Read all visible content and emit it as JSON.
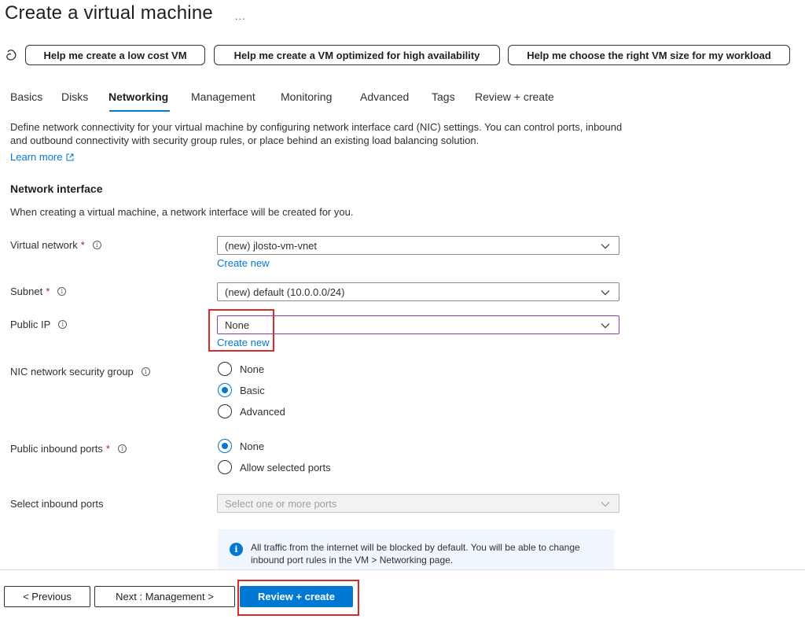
{
  "page": {
    "title": "Create a virtual machine",
    "more": "..."
  },
  "copilot": {
    "icon": "copilot-icon",
    "prompts": [
      "Help me create a low cost VM",
      "Help me create a VM optimized for high availability",
      "Help me choose the right VM size for my workload"
    ]
  },
  "tabs": [
    {
      "label": "Basics"
    },
    {
      "label": "Disks"
    },
    {
      "label": "Networking",
      "active": true
    },
    {
      "label": "Management"
    },
    {
      "label": "Monitoring"
    },
    {
      "label": "Advanced"
    },
    {
      "label": "Tags"
    },
    {
      "label": "Review + create"
    }
  ],
  "intro": {
    "description": "Define network connectivity for your virtual machine by configuring network interface card (NIC) settings. You can control ports, inbound and outbound connectivity with security group rules, or place behind an existing load balancing solution.",
    "learn_more": "Learn more"
  },
  "network_interface": {
    "title": "Network interface",
    "subtitle": "When creating a virtual machine, a network interface will be created for you.",
    "virtual_network": {
      "label": "Virtual network",
      "required": "*",
      "value": "(new) jlosto-vm-vnet",
      "create_new": "Create new"
    },
    "subnet": {
      "label": "Subnet",
      "required": "*",
      "value": "(new) default (10.0.0.0/24)"
    },
    "public_ip": {
      "label": "Public IP",
      "value": "None",
      "create_new": "Create new"
    },
    "nic_nsg": {
      "label": "NIC network security group",
      "options": [
        "None",
        "Basic",
        "Advanced"
      ],
      "selected": "Basic"
    },
    "public_inbound_ports": {
      "label": "Public inbound ports",
      "required": "*",
      "options": [
        "None",
        "Allow selected ports"
      ],
      "selected": "None"
    },
    "select_inbound_ports": {
      "label": "Select inbound ports",
      "placeholder": "Select one or more ports"
    },
    "info": {
      "text": "All traffic from the internet will be blocked by default. You will be able to change inbound port rules in the VM > Networking page."
    }
  },
  "footer": {
    "previous": "< Previous",
    "next": "Next : Management >",
    "review": "Review + create"
  },
  "colors": {
    "accent": "#0078d4",
    "highlight": "#d92b2b",
    "required": "#a4262c"
  }
}
